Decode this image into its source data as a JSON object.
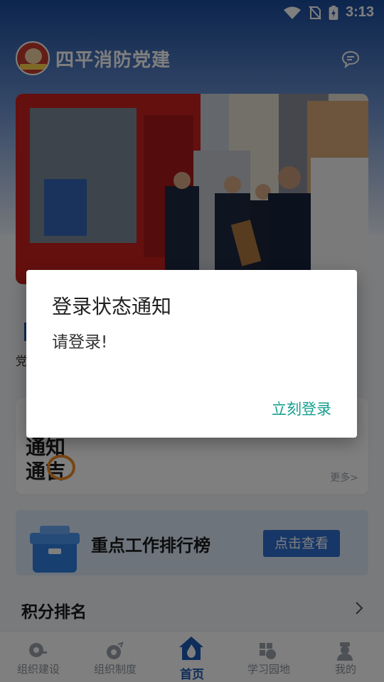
{
  "status_bar": {
    "time": "3:13"
  },
  "app_bar": {
    "title": "四平消防党建",
    "logo_text": "四平消防"
  },
  "modules": {
    "first_label": "党"
  },
  "notice": {
    "logo_line1": "通知",
    "logo_line2": "通吉",
    "more": "更多>"
  },
  "rank": {
    "title": "重点工作排行榜",
    "button": "点击查看"
  },
  "score": {
    "title": "积分排名"
  },
  "tabs": [
    {
      "label": "组织建设",
      "icon": "org-build-icon"
    },
    {
      "label": "组织制度",
      "icon": "org-system-icon"
    },
    {
      "label": "首页",
      "icon": "home-icon"
    },
    {
      "label": "学习园地",
      "icon": "study-icon"
    },
    {
      "label": "我的",
      "icon": "profile-icon"
    }
  ],
  "dialog": {
    "title": "登录状态通知",
    "message": "请登录!",
    "action": "立刻登录"
  },
  "colors": {
    "brand_blue": "#1f5bb4",
    "dialog_action": "#15a08f",
    "scrim": "rgba(0,0,0,0.5)"
  }
}
